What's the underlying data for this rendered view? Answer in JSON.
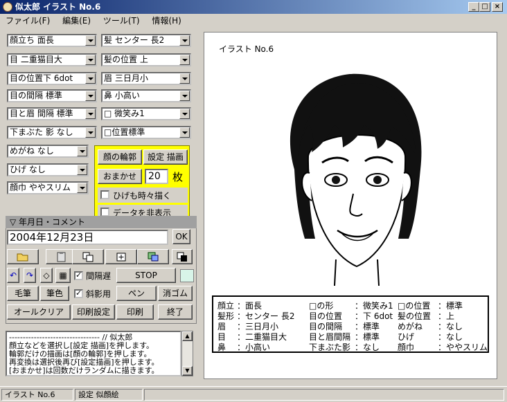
{
  "window": {
    "title": "似太郎  イラスト No.6"
  },
  "menu": [
    "ファイル(F)",
    "編集(E)",
    "ツール(T)",
    "情報(H)"
  ],
  "left_col": [
    "顔立ち 面長",
    "目 二重猫目大",
    "目の位置下 6dot",
    "目の間隔 標準",
    "目と眉 間隔 標準",
    "下まぶた 影 なし",
    "めがね なし",
    "ひげ なし",
    "顔巾  ややスリム"
  ],
  "right_col": [
    "髪 センター 長2",
    "髪の位置 上",
    "眉 三日月小",
    "鼻 小高い",
    "□ 微笑み1",
    "□位置標準"
  ],
  "panel": {
    "outline_btn": "顔の輪郭",
    "draw_btn": "設定 描画",
    "auto_btn": "おまかせ",
    "count_value": "20",
    "count_unit": "枚",
    "beard_label": "ひげも時々描く",
    "hide_label": "データを非表示"
  },
  "date_panel": {
    "header": "▽ 年月日・コメント",
    "date_value": "2004年12月23日",
    "ok_label": "OK"
  },
  "controls": {
    "interval_label": "間隔遅",
    "shade_label": "斜影用",
    "stop_label": "STOP",
    "brush_label": "毛筆",
    "pen_color_label": "筆色",
    "pen_label": "ペン",
    "eraser_label": "消ゴム",
    "clear_label": "オールクリア",
    "print_setup_label": "印刷設定",
    "print_label": "印刷",
    "exit_label": "終了"
  },
  "log": {
    "text": "--------------------------------- // 似太郎\n顔立などを選択し[設定 描画]を押します。\n輪郭だけの描画は[顔の輪郭]を押します。\n再変換は選択後再び[設定描画]を押します。\n[おまかせ]は回数だけランダムに描きます。"
  },
  "canvas": {
    "title": "イラスト No.6"
  },
  "info": [
    [
      "顔立",
      "：面長",
      "□の形",
      "：微笑み1",
      "□の位置",
      "：標準"
    ],
    [
      "髪形",
      "：センター 長2",
      "目の位置",
      "：下 6dot",
      "髪の位置",
      "：上"
    ],
    [
      "眉",
      "：三日月小",
      "目の間隔",
      "：標準",
      "めがね",
      "：なし"
    ],
    [
      "目",
      "：二重猫目大",
      "目と眉間隔",
      "：標準",
      "ひげ",
      "：なし"
    ],
    [
      "鼻",
      "：小高い",
      "下まぶた影",
      "：なし",
      "顔巾",
      "：ややスリム"
    ]
  ],
  "status": {
    "left": "イラスト No.6",
    "mid": "設定 似顔絵"
  }
}
